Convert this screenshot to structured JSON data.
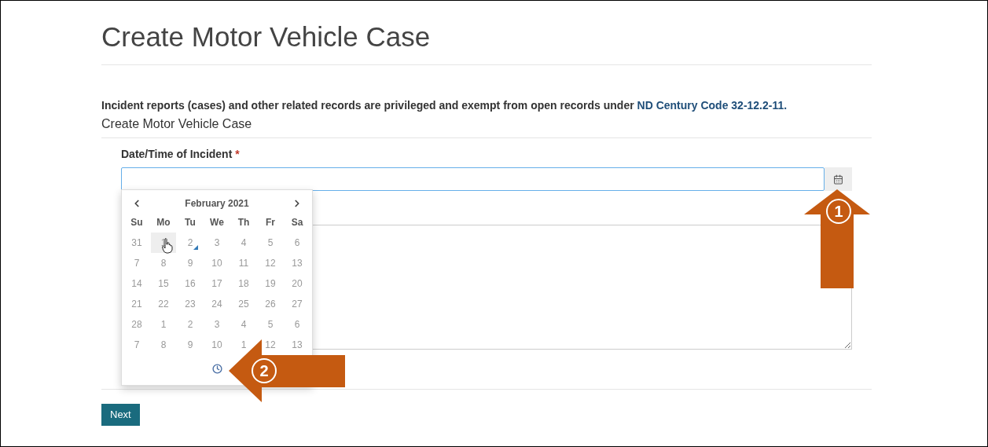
{
  "page": {
    "title": "Create Motor Vehicle Case"
  },
  "notice": {
    "text": "Incident reports (cases) and other related records are privileged and exempt from open records under ",
    "link": "ND Century Code 32-12.2-11."
  },
  "subtitle": "Create Motor Vehicle Case",
  "field": {
    "label": "Date/Time of Incident",
    "required": true,
    "required_mark": "*"
  },
  "calendar": {
    "month": "February 2021",
    "weekdays": [
      "Su",
      "Mo",
      "Tu",
      "We",
      "Th",
      "Fr",
      "Sa"
    ],
    "weeks": [
      [
        {
          "day": "31",
          "hovered": false,
          "today": false
        },
        {
          "day": "1",
          "hovered": true,
          "today": false
        },
        {
          "day": "2",
          "hovered": false,
          "today": true
        },
        {
          "day": "3",
          "hovered": false,
          "today": false
        },
        {
          "day": "4",
          "hovered": false,
          "today": false
        },
        {
          "day": "5",
          "hovered": false,
          "today": false
        },
        {
          "day": "6",
          "hovered": false,
          "today": false
        }
      ],
      [
        {
          "day": "7",
          "hovered": false,
          "today": false
        },
        {
          "day": "8",
          "hovered": false,
          "today": false
        },
        {
          "day": "9",
          "hovered": false,
          "today": false
        },
        {
          "day": "10",
          "hovered": false,
          "today": false
        },
        {
          "day": "11",
          "hovered": false,
          "today": false
        },
        {
          "day": "12",
          "hovered": false,
          "today": false
        },
        {
          "day": "13",
          "hovered": false,
          "today": false
        }
      ],
      [
        {
          "day": "14",
          "hovered": false,
          "today": false
        },
        {
          "day": "15",
          "hovered": false,
          "today": false
        },
        {
          "day": "16",
          "hovered": false,
          "today": false
        },
        {
          "day": "17",
          "hovered": false,
          "today": false
        },
        {
          "day": "18",
          "hovered": false,
          "today": false
        },
        {
          "day": "19",
          "hovered": false,
          "today": false
        },
        {
          "day": "20",
          "hovered": false,
          "today": false
        }
      ],
      [
        {
          "day": "21",
          "hovered": false,
          "today": false
        },
        {
          "day": "22",
          "hovered": false,
          "today": false
        },
        {
          "day": "23",
          "hovered": false,
          "today": false
        },
        {
          "day": "24",
          "hovered": false,
          "today": false
        },
        {
          "day": "25",
          "hovered": false,
          "today": false
        },
        {
          "day": "26",
          "hovered": false,
          "today": false
        },
        {
          "day": "27",
          "hovered": false,
          "today": false
        }
      ],
      [
        {
          "day": "28",
          "hovered": false,
          "today": false
        },
        {
          "day": "1",
          "hovered": false,
          "today": false
        },
        {
          "day": "2",
          "hovered": false,
          "today": false
        },
        {
          "day": "3",
          "hovered": false,
          "today": false
        },
        {
          "day": "4",
          "hovered": false,
          "today": false
        },
        {
          "day": "5",
          "hovered": false,
          "today": false
        },
        {
          "day": "6",
          "hovered": false,
          "today": false
        }
      ],
      [
        {
          "day": "7",
          "hovered": false,
          "today": false
        },
        {
          "day": "8",
          "hovered": false,
          "today": false
        },
        {
          "day": "9",
          "hovered": false,
          "today": false
        },
        {
          "day": "10",
          "hovered": false,
          "today": false
        },
        {
          "day": "1",
          "hovered": false,
          "today": false
        },
        {
          "day": "12",
          "hovered": false,
          "today": false
        },
        {
          "day": "13",
          "hovered": false,
          "today": false
        }
      ]
    ]
  },
  "next_button": "Next",
  "callouts": [
    {
      "number": "1",
      "kind": "up"
    },
    {
      "number": "2",
      "kind": "left"
    }
  ]
}
